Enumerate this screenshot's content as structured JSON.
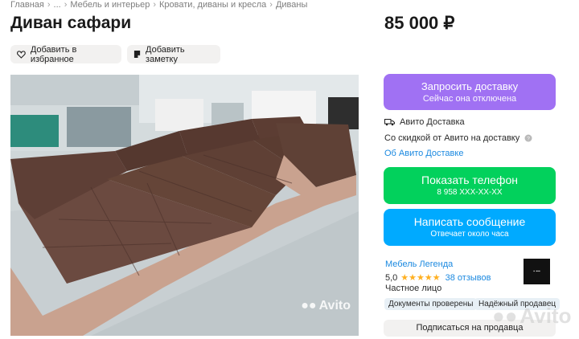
{
  "breadcrumbs": [
    "Главная",
    "...",
    "Мебель и интерьер",
    "Кровати, диваны и кресла",
    "Диваны"
  ],
  "listing": {
    "title": "Диван сафари",
    "price": "85 000 ₽"
  },
  "actions": {
    "favorite": "Добавить в избранное",
    "note": "Добавить заметку"
  },
  "photo": {
    "watermark": "Avito"
  },
  "delivery": {
    "button_title": "Запросить доставку",
    "button_sub": "Сейчас она отключена",
    "service": "Авито Доставка",
    "discount": "Со скидкой от Авито на доставку",
    "about_link": "Об Авито Доставке"
  },
  "contact": {
    "phone_title": "Показать телефон",
    "phone_sub": "8 958 XXX-XX-XX",
    "msg_title": "Написать сообщение",
    "msg_sub": "Отвечает около часа"
  },
  "seller": {
    "name": "Мебель Легенда",
    "rating": "5,0",
    "stars": "★★★★★",
    "reviews": "38 отзывов",
    "type": "Частное лицо",
    "badges": [
      "Документы проверены",
      "Надёжный продавец"
    ],
    "subscribe": "Подписаться на продавца"
  },
  "colors": {
    "delivery": "#a071f3",
    "phone": "#02d15c",
    "message": "#00aaff",
    "link": "#1b89e0"
  }
}
